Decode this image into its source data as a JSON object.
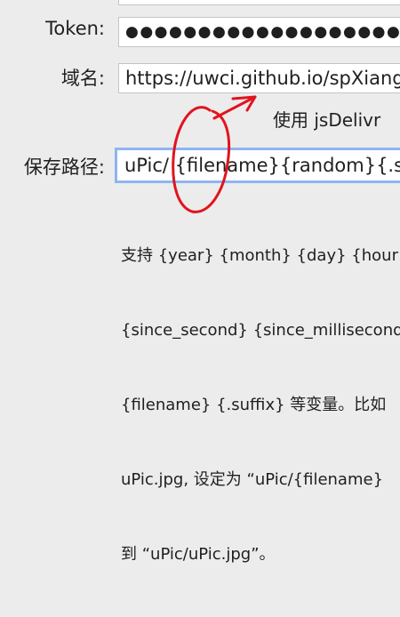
{
  "form": {
    "token": {
      "label": "Token:",
      "value": "●●●●●●●●●●●●●●●●●●●●●●●●●●"
    },
    "domain": {
      "label": "域名:",
      "value": "https://uwci.github.io/spXiangwei"
    },
    "jsdelivr": {
      "label": "使用 jsDelivr"
    },
    "save_path": {
      "label": "保存路径:",
      "value": "uPic/ {filename}{random}{.suffix}"
    },
    "hint_lines": [
      "支持 {year} {month} {day} {hour}",
      "{since_second} {since_millisecond}",
      "{filename} {.suffix} 等变量。比如",
      "uPic.jpg, 设定为 “uPic/{filename}",
      "到 “uPic/uPic.jpg”。"
    ]
  },
  "colors": {
    "window_bg": "#ececec",
    "field_bg": "#ffffff",
    "focus_ring": "#8fb5f0",
    "annotation": "#e0141e"
  }
}
